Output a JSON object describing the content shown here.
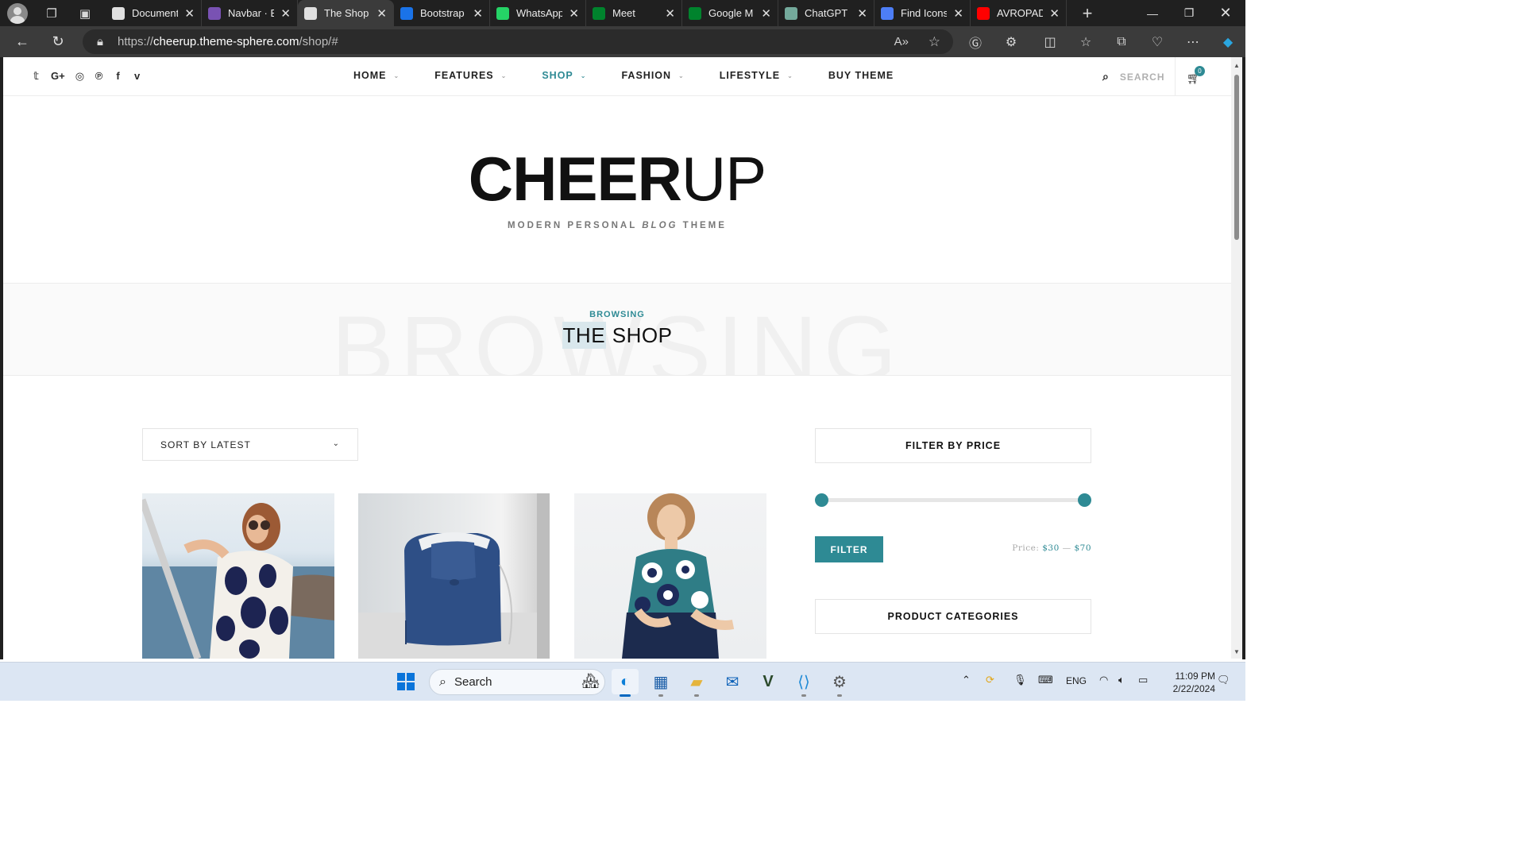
{
  "browser": {
    "tabs": [
      {
        "title": "Document",
        "icon": "document-icon",
        "color": "#e0e0e0"
      },
      {
        "title": "Navbar · B",
        "icon": "bootstrap-icon",
        "color": "#7952b3"
      },
      {
        "title": "The Shop",
        "icon": "wordpress-icon",
        "color": "#e0e0e0",
        "active": true
      },
      {
        "title": "Bootstrap",
        "icon": "lightning-icon",
        "color": "#1a73e8"
      },
      {
        "title": "WhatsApp",
        "icon": "whatsapp-icon",
        "color": "#25d366"
      },
      {
        "title": "Meet",
        "icon": "meet-icon",
        "color": "#00832d"
      },
      {
        "title": "Google M",
        "icon": "meet-icon",
        "color": "#00832d"
      },
      {
        "title": "ChatGPT",
        "icon": "chatgpt-icon",
        "color": "#74aa9c"
      },
      {
        "title": "Find Icons",
        "icon": "flag-icon",
        "color": "#4d7ef7"
      },
      {
        "title": "AVROPAD",
        "icon": "youtube-icon",
        "color": "#ff0000"
      }
    ],
    "url_prefix": "https://",
    "url_host": "cheerup.theme-sphere.com",
    "url_path": "/shop/#"
  },
  "site": {
    "socials": [
      "twitter-icon",
      "google-plus-icon",
      "instagram-icon",
      "pinterest-icon",
      "facebook-icon",
      "vimeo-icon"
    ],
    "social_glyphs": [
      "𝕥",
      "G+",
      "◎",
      "℗",
      "f",
      "v"
    ],
    "menu": [
      {
        "label": "HOME",
        "active": false
      },
      {
        "label": "FEATURES",
        "active": false
      },
      {
        "label": "SHOP",
        "active": true
      },
      {
        "label": "FASHION",
        "active": false
      },
      {
        "label": "LIFESTYLE",
        "active": false
      },
      {
        "label": "BUY THEME",
        "active": false,
        "no_chevron": true
      }
    ],
    "search_placeholder": "SEARCH",
    "cart_count": "0",
    "accent_color": "#2e8a94"
  },
  "logo": {
    "brand_bold": "CHEER",
    "brand_light": "UP",
    "tagline_a": "MODERN PERSONAL ",
    "tagline_b": "BLOG",
    "tagline_c": " THEME"
  },
  "header_band": {
    "ghost": "BROWSING",
    "kicker": "BROWSING",
    "title_highlight": "THE",
    "title_rest": " SHOP"
  },
  "shop": {
    "sort_label": "SORT BY LATEST"
  },
  "sidebar": {
    "filter_title": "FILTER BY PRICE",
    "filter_button": "FILTER",
    "price_prefix": "Price:",
    "price_min": "$30",
    "price_sep": "—",
    "price_max": "$70",
    "categories_title": "PRODUCT CATEGORIES"
  },
  "taskbar": {
    "search_label": "Search",
    "language": "ENG",
    "time": "11:09 PM",
    "date": "2/22/2024"
  }
}
